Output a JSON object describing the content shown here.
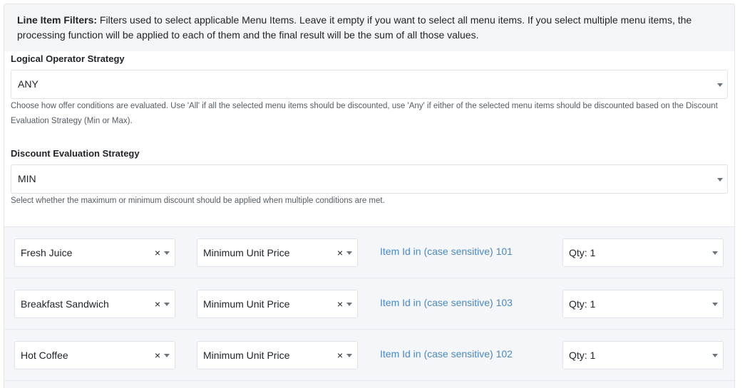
{
  "info": {
    "title": "Line Item Filters:",
    "text": "Filters used to select applicable Menu Items. Leave it empty if you want to select all menu items. If you select multiple menu items, the processing function will be applied to each of them and the final result will be the sum of all those values."
  },
  "logical": {
    "label": "Logical Operator Strategy",
    "value": "ANY",
    "help": "Choose how offer conditions are evaluated. Use 'All' if all the selected menu items should be discounted, use 'Any' if either of the selected menu items should be discounted based on the Discount Evaluation Strategy (Min or Max)."
  },
  "discount": {
    "label": "Discount Evaluation Strategy",
    "value": "MIN",
    "help": "Select whether the maximum or minimum discount should be applied when multiple conditions are met."
  },
  "rows": [
    {
      "item": "Fresh Juice",
      "function": "Minimum Unit Price",
      "link": "Item Id in (case sensitive) 101",
      "qty": "Qty: 1"
    },
    {
      "item": "Breakfast Sandwich",
      "function": "Minimum Unit Price",
      "link": "Item Id in (case sensitive) 103",
      "qty": "Qty: 1"
    },
    {
      "item": "Hot Coffee",
      "function": "Minimum Unit Price",
      "link": "Item Id in (case sensitive) 102",
      "qty": "Qty: 1"
    }
  ],
  "clear_symbol": "×"
}
